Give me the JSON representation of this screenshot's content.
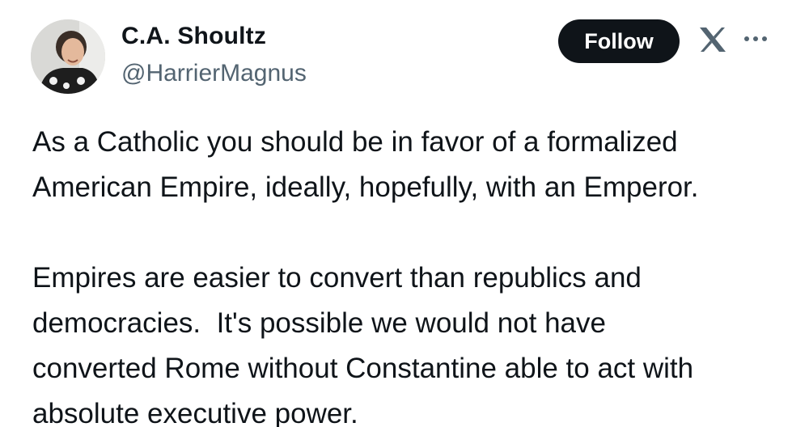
{
  "author": {
    "display_name": "C.A. Shoultz",
    "handle": "@HarrierMagnus",
    "avatar_icon": "user-avatar"
  },
  "actions": {
    "follow_label": "Follow",
    "logo_icon": "x-logo-icon",
    "more_icon": "more-options-icon"
  },
  "tweet": {
    "paragraphs": [
      "As a Catholic you should be in favor of a formalized\nAmerican Empire, ideally, hopefully, with an Emperor.",
      "Empires are easier to convert than republics and\ndemocracies.  It's possible we would not have\nconverted Rome without Constantine able to act with\nabsolute executive power."
    ]
  },
  "colors": {
    "text_primary": "#0f1419",
    "text_secondary": "#536471",
    "button_bg": "#0f1419",
    "button_text": "#ffffff"
  }
}
